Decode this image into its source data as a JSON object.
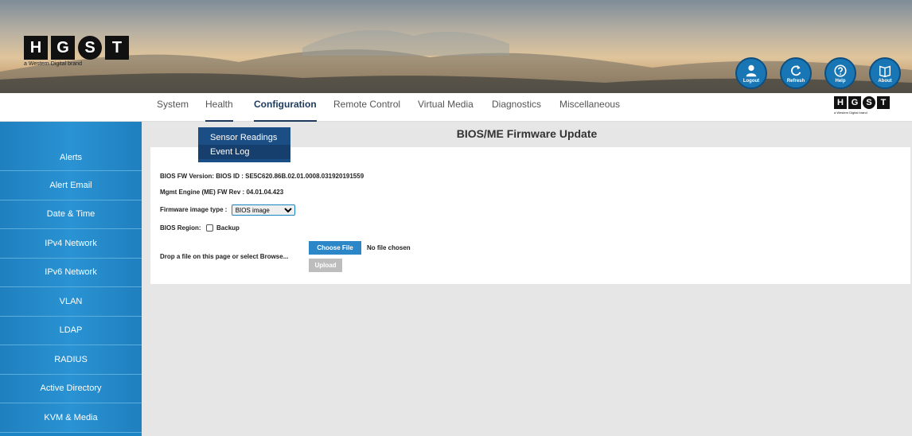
{
  "brand": {
    "letters": [
      "H",
      "G",
      "S",
      "T"
    ],
    "tagline": "a Western Digital brand"
  },
  "top_buttons": [
    {
      "label": "Logout",
      "icon": "user-logout-icon"
    },
    {
      "label": "Refresh",
      "icon": "refresh-icon"
    },
    {
      "label": "Help",
      "icon": "help-icon"
    },
    {
      "label": "About",
      "icon": "book-icon"
    }
  ],
  "nav": {
    "items": [
      "System",
      "Health",
      "Configuration",
      "Remote Control",
      "Virtual Media",
      "Diagnostics",
      "Miscellaneous"
    ],
    "active": "Configuration",
    "open": "Health"
  },
  "health_menu": [
    "Sensor Readings",
    "Event Log"
  ],
  "sidebar": {
    "items": [
      "Alerts",
      "Alert Email",
      "Date & Time",
      "IPv4 Network",
      "IPv6 Network",
      "VLAN",
      "LDAP",
      "RADIUS",
      "Active Directory",
      "KVM & Media"
    ]
  },
  "page": {
    "title": "BIOS/ME Firmware Update",
    "bios_fw_version": "BIOS FW Version:  BIOS ID : SE5C620.86B.02.01.0008.031920191559",
    "me_fw_rev": "Mgmt Engine (ME) FW Rev : 04.01.04.423",
    "firmware_type_label": "Firmware image type :",
    "firmware_type_value": "BIOS image",
    "bios_region_label": "BIOS Region:",
    "backup_label": "Backup",
    "backup_checked": false,
    "drop_label": "Drop a file on this page or select Browse...",
    "choose_file": "Choose File",
    "no_file": "No file chosen",
    "upload": "Upload"
  },
  "colors": {
    "accent": "#1a84c4",
    "nav_active": "#1b3a5c",
    "dropdown": "#1c4e86"
  }
}
